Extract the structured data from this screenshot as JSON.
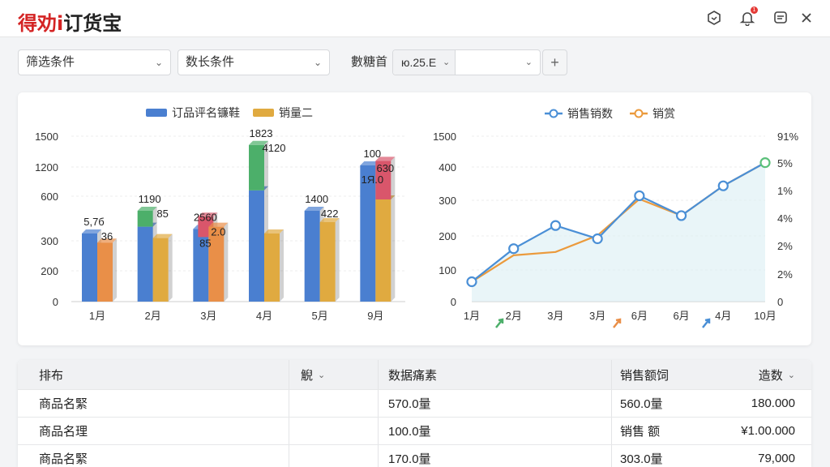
{
  "header": {
    "logo_brand": "得劝i",
    "logo_rest": "订货宝",
    "notification_badge": "1"
  },
  "filters": {
    "filter1": "筛选条件",
    "filter2": "数长条件",
    "date_label": "數糖首",
    "date_part1": "ю.25.Е",
    "date_part2": ""
  },
  "colors": {
    "blue": "#4a7fd0",
    "orange": "#e98f48",
    "gold": "#e0aa40",
    "green": "#4caf6a",
    "red": "#d9566b",
    "line_blue": "#4a8fd6",
    "line_orange": "#eb9a3c",
    "line_green": "#5bc07a"
  },
  "chart_data": [
    {
      "type": "bar",
      "legend": [
        "订品评名镰鞋",
        "销量二"
      ],
      "legend_position": "top-center",
      "categories": [
        "1月",
        "2月",
        "3月",
        "4月",
        "5月",
        "9月"
      ],
      "ytick_labels": [
        "0",
        "200",
        "300",
        "600",
        "1200",
        "1500"
      ],
      "series": [
        {
          "name": "订品评名镰鞋",
          "values": [
            300,
            330,
            320,
            490,
            400,
            600
          ],
          "cap": [
            0,
            70,
            0,
            200,
            0,
            0
          ],
          "cap_color": [
            "",
            "green",
            "",
            "green",
            "",
            ""
          ]
        },
        {
          "name": "销量二",
          "values": [
            260,
            280,
            330,
            300,
            350,
            450
          ],
          "cap": [
            0,
            0,
            0,
            0,
            0,
            170
          ],
          "cap_color": [
            "",
            "",
            "",
            "",
            "",
            "red"
          ],
          "cap_on_blue": [
            0,
            0,
            90,
            0,
            0,
            0
          ]
        }
      ],
      "ymax": 750,
      "data_labels": [
        [
          "5,7б",
          "36"
        ],
        [
          "1190",
          "85"
        ],
        [
          "2560",
          "2.0",
          "85"
        ],
        [
          "1823",
          "4120"
        ],
        [
          "1400",
          "422"
        ],
        [
          "100",
          "630",
          "1Я.0"
        ]
      ]
    },
    {
      "type": "line",
      "legend": [
        "销售销数",
        "销赏"
      ],
      "legend_position": "top-right",
      "categories": [
        "1月",
        "2月",
        "3月",
        "3月",
        "6月",
        "6月",
        "4月",
        "10月"
      ],
      "ytick_labels_left": [
        "0",
        "100",
        "200",
        "300",
        "400",
        "1500"
      ],
      "ytick_labels_right": [
        "0",
        "2%",
        "2%",
        "4%",
        "1%",
        "5%",
        "91%"
      ],
      "series": [
        {
          "name": "销售销数",
          "values": [
            60,
            160,
            230,
            190,
            320,
            260,
            350,
            420
          ]
        },
        {
          "name": "销赏",
          "values": [
            60,
            140,
            150,
            200,
            310,
            260,
            350,
            420
          ]
        }
      ],
      "ymax": 500,
      "markers": [
        "green",
        "orange",
        "blue"
      ]
    }
  ],
  "table": {
    "headers": [
      "排布",
      "觬",
      "数据痛素",
      "销售额饲",
      "造数"
    ],
    "rows": [
      [
        "商品名緊",
        "",
        "570.0量",
        "560.0量",
        "180.000"
      ],
      [
        "商品名理",
        "",
        "100.0量",
        "销售 额",
        "¥1.00.000"
      ],
      [
        "商品名緊",
        "",
        "170.0量",
        "303.0量",
        "79,000"
      ]
    ]
  }
}
